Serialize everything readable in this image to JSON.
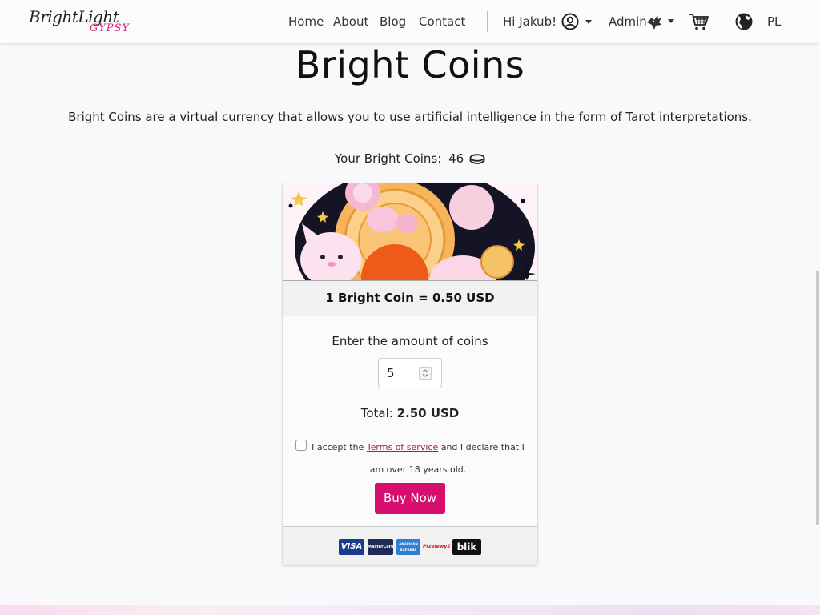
{
  "nav": {
    "logo_line1": "BrightLight",
    "logo_line2": "GYPSY",
    "links": [
      "Home",
      "About",
      "Blog",
      "Contact"
    ],
    "user_greeting": "Hi Jakub!",
    "admin_label": "Admin",
    "language": "PL"
  },
  "page": {
    "title": "Bright Coins",
    "description": "Bright Coins are a virtual currency that allows you to use artificial intelligence in the form of Tarot interpretations.",
    "balance_label": "Your Bright Coins:",
    "balance_value": "46"
  },
  "card": {
    "rate": "1 Bright Coin = 0.50 USD",
    "enter_label": "Enter the amount of coins",
    "quantity": "5",
    "total_label": "Total:",
    "total_value": "2.50 USD",
    "terms_prefix": "I accept the",
    "terms_link": "Terms of service",
    "terms_suffix": "and I declare that I am over 18 years old.",
    "buy_label": "Buy Now",
    "payment_methods": [
      "VISA",
      "MasterCard",
      "AMERICAN EXPRESS",
      "Przelewy24",
      "blik"
    ]
  },
  "colors": {
    "accent": "#d80e6e",
    "link": "#b0106a"
  }
}
